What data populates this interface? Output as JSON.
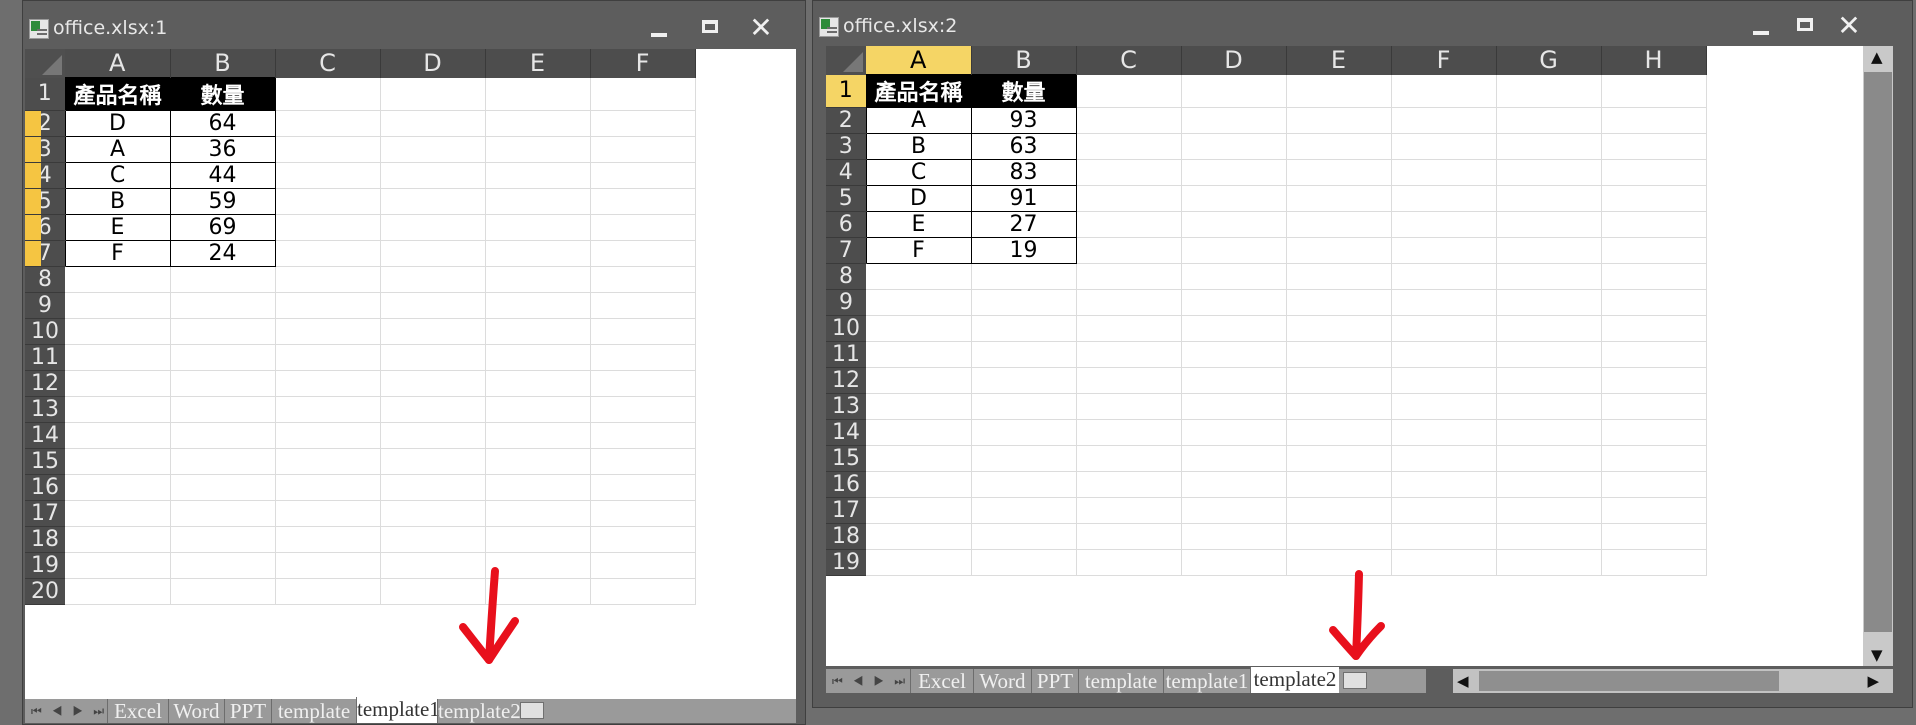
{
  "window1": {
    "title": "office.xlsx:1",
    "columns": [
      "A",
      "B",
      "C",
      "D",
      "E",
      "F"
    ],
    "rows": [
      "1",
      "2",
      "3",
      "4",
      "5",
      "6",
      "7",
      "8",
      "9",
      "10",
      "11",
      "12",
      "13",
      "14",
      "15",
      "16",
      "17",
      "18",
      "19",
      "20"
    ],
    "header": [
      "產品名稱",
      "數量"
    ],
    "data": [
      [
        "D",
        "64"
      ],
      [
        "A",
        "36"
      ],
      [
        "C",
        "44"
      ],
      [
        "B",
        "59"
      ],
      [
        "E",
        "69"
      ],
      [
        "F",
        "24"
      ]
    ],
    "tabs": [
      "Excel",
      "Word",
      "PPT",
      "template",
      "template1",
      "template2"
    ],
    "active_tab": "template1"
  },
  "window2": {
    "title": "office.xlsx:2",
    "columns": [
      "A",
      "B",
      "C",
      "D",
      "E",
      "F",
      "G",
      "H"
    ],
    "rows": [
      "1",
      "2",
      "3",
      "4",
      "5",
      "6",
      "7",
      "8",
      "9",
      "10",
      "11",
      "12",
      "13",
      "14",
      "15",
      "16",
      "17",
      "18",
      "19"
    ],
    "header": [
      "產品名稱",
      "數量"
    ],
    "data": [
      [
        "A",
        "93"
      ],
      [
        "B",
        "63"
      ],
      [
        "C",
        "83"
      ],
      [
        "D",
        "91"
      ],
      [
        "E",
        "27"
      ],
      [
        "F",
        "19"
      ]
    ],
    "tabs": [
      "Excel",
      "Word",
      "PPT",
      "template",
      "template1",
      "template2"
    ],
    "active_tab": "template2"
  },
  "colors": {
    "annotation": "#e8101c",
    "selection": "#f5d565",
    "row_marker": "#f5c542"
  },
  "icons": [
    "excel-file-icon",
    "minimize-icon",
    "maximize-icon",
    "close-icon",
    "new-sheet-icon",
    "annotation-arrow-icon"
  ]
}
